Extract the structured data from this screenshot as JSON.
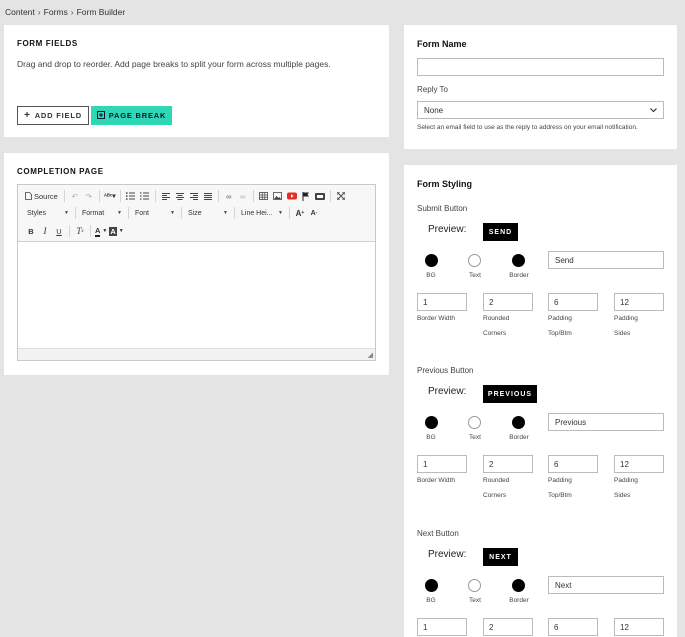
{
  "breadcrumb": [
    "Content",
    "Forms",
    "Form Builder"
  ],
  "breadcrumb_sep": "›",
  "form_fields": {
    "title": "FORM FIELDS",
    "description": "Drag and drop to reorder. Add page breaks to split your form across multiple pages.",
    "add_field_label": "ADD FIELD",
    "page_break_label": "PAGE BREAK"
  },
  "completion": {
    "title": "COMPLETION PAGE",
    "toolbar": {
      "source_label": "Source",
      "styles_label": "Styles",
      "format_label": "Format",
      "font_label": "Font",
      "size_label": "Size",
      "line_height_label": "Line Hei..."
    }
  },
  "form_name": {
    "title": "Form Name",
    "value": "",
    "reply_to_label": "Reply To",
    "reply_to_value": "None",
    "hint": "Select an email field to use as the reply to address on your email notification."
  },
  "styling": {
    "title": "Form Styling",
    "preview_label": "Preview:",
    "swatch_labels": [
      "BG",
      "Text",
      "Border"
    ],
    "field_labels": {
      "border_width": "Border Width",
      "rounded": "Rounded",
      "corners": "Corners",
      "padding": "Padding",
      "top_btm": "Top/Btm",
      "sides": "Sides"
    },
    "buttons": [
      {
        "section": "Submit Button",
        "preview_text": "SEND",
        "text_value": "Send",
        "border_width": "1",
        "rounded": "2",
        "padding_tb": "6",
        "padding_sides": "12"
      },
      {
        "section": "Previous Button",
        "preview_text": "PREVIOUS",
        "text_value": "Previous",
        "border_width": "1",
        "rounded": "2",
        "padding_tb": "6",
        "padding_sides": "12"
      },
      {
        "section": "Next Button",
        "preview_text": "NEXT",
        "text_value": "Next",
        "border_width": "1",
        "rounded": "2",
        "padding_tb": "6",
        "padding_sides": "12"
      }
    ]
  },
  "colors": {
    "accent": "#2ed8b6",
    "background": "#e4e4e4"
  }
}
